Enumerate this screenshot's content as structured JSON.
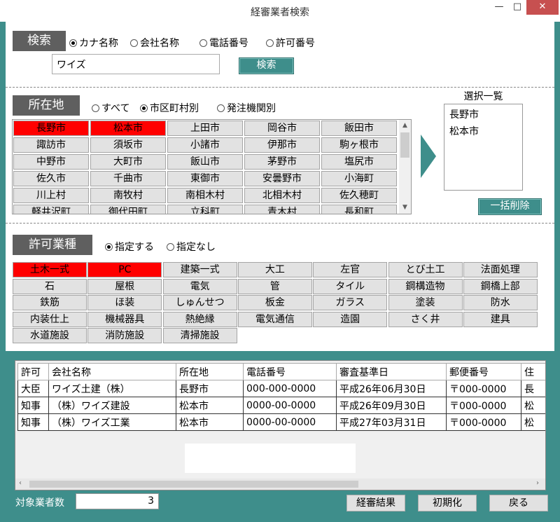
{
  "window": {
    "title": "経審業者検索",
    "min_glyph": "—",
    "max_glyph": "□",
    "close_glyph": "✕"
  },
  "search": {
    "label": "検索",
    "options": [
      {
        "label": "カナ名称",
        "checked": true
      },
      {
        "label": "会社名称",
        "checked": false
      },
      {
        "label": "電話番号",
        "checked": false
      },
      {
        "label": "許可番号",
        "checked": false
      }
    ],
    "value": "ワイズ",
    "button": "検索"
  },
  "location": {
    "label": "所在地",
    "options": [
      {
        "label": "すべて",
        "checked": false
      },
      {
        "label": "市区町村別",
        "checked": true
      },
      {
        "label": "発注機関別",
        "checked": false
      }
    ],
    "cities": [
      {
        "label": "長野市",
        "selected": true
      },
      {
        "label": "松本市",
        "selected": true
      },
      {
        "label": "上田市",
        "selected": false
      },
      {
        "label": "岡谷市",
        "selected": false
      },
      {
        "label": "飯田市",
        "selected": false
      },
      {
        "label": "諏訪市",
        "selected": false
      },
      {
        "label": "須坂市",
        "selected": false
      },
      {
        "label": "小諸市",
        "selected": false
      },
      {
        "label": "伊那市",
        "selected": false
      },
      {
        "label": "駒ヶ根市",
        "selected": false
      },
      {
        "label": "中野市",
        "selected": false
      },
      {
        "label": "大町市",
        "selected": false
      },
      {
        "label": "飯山市",
        "selected": false
      },
      {
        "label": "茅野市",
        "selected": false
      },
      {
        "label": "塩尻市",
        "selected": false
      },
      {
        "label": "佐久市",
        "selected": false
      },
      {
        "label": "千曲市",
        "selected": false
      },
      {
        "label": "東御市",
        "selected": false
      },
      {
        "label": "安曇野市",
        "selected": false
      },
      {
        "label": "小海町",
        "selected": false
      },
      {
        "label": "川上村",
        "selected": false
      },
      {
        "label": "南牧村",
        "selected": false
      },
      {
        "label": "南相木村",
        "selected": false
      },
      {
        "label": "北相木村",
        "selected": false
      },
      {
        "label": "佐久穂町",
        "selected": false
      },
      {
        "label": "軽井沢町",
        "selected": false
      },
      {
        "label": "御代田町",
        "selected": false
      },
      {
        "label": "立科町",
        "selected": false
      },
      {
        "label": "青木村",
        "selected": false
      },
      {
        "label": "長和町",
        "selected": false
      }
    ]
  },
  "selection": {
    "title": "選択一覧",
    "items": [
      "長野市",
      "松本市"
    ],
    "clear_button": "一括削除"
  },
  "license_type": {
    "label": "許可業種",
    "options": [
      {
        "label": "指定する",
        "checked": true
      },
      {
        "label": "指定なし",
        "checked": false
      }
    ],
    "types": [
      {
        "label": "土木一式",
        "selected": true
      },
      {
        "label": "PC",
        "selected": true
      },
      {
        "label": "建築一式",
        "selected": false
      },
      {
        "label": "大工",
        "selected": false
      },
      {
        "label": "左官",
        "selected": false
      },
      {
        "label": "とび土工",
        "selected": false
      },
      {
        "label": "法面処理",
        "selected": false
      },
      {
        "label": "石",
        "selected": false
      },
      {
        "label": "屋根",
        "selected": false
      },
      {
        "label": "電気",
        "selected": false
      },
      {
        "label": "管",
        "selected": false
      },
      {
        "label": "タイル",
        "selected": false
      },
      {
        "label": "鋼構造物",
        "selected": false
      },
      {
        "label": "鋼橋上部",
        "selected": false
      },
      {
        "label": "鉄筋",
        "selected": false
      },
      {
        "label": "ほ装",
        "selected": false
      },
      {
        "label": "しゅんせつ",
        "selected": false
      },
      {
        "label": "板金",
        "selected": false
      },
      {
        "label": "ガラス",
        "selected": false
      },
      {
        "label": "塗装",
        "selected": false
      },
      {
        "label": "防水",
        "selected": false
      },
      {
        "label": "内装仕上",
        "selected": false
      },
      {
        "label": "機械器具",
        "selected": false
      },
      {
        "label": "熱絶縁",
        "selected": false
      },
      {
        "label": "電気通信",
        "selected": false
      },
      {
        "label": "造園",
        "selected": false
      },
      {
        "label": "さく井",
        "selected": false
      },
      {
        "label": "建具",
        "selected": false
      },
      {
        "label": "水道施設",
        "selected": false
      },
      {
        "label": "消防施設",
        "selected": false
      },
      {
        "label": "清掃施設",
        "selected": false
      }
    ]
  },
  "results": {
    "columns": [
      "許可",
      "会社名称",
      "所在地",
      "電話番号",
      "審査基準日",
      "郵便番号",
      "住"
    ],
    "rows": [
      [
        "大臣",
        "ワイズ土建（株）",
        "長野市",
        "000-000-0000",
        "平成26年06月30日",
        "〒000-0000",
        "長"
      ],
      [
        "知事",
        "（株）ワイズ建設",
        "松本市",
        "0000-00-0000",
        "平成26年09月30日",
        "〒000-0000",
        "松"
      ],
      [
        "知事",
        "（株）ワイズ工業",
        "松本市",
        "0000-00-0000",
        "平成27年03月31日",
        "〒000-0000",
        "松"
      ]
    ]
  },
  "footer": {
    "count_label": "対象業者数",
    "count_value": "3",
    "buttons": [
      "経審結果",
      "初期化",
      "戻る"
    ]
  },
  "colors": {
    "accent": "#3e8e8b",
    "selected": "#ff0000",
    "label_bg": "#5f5f5f"
  }
}
